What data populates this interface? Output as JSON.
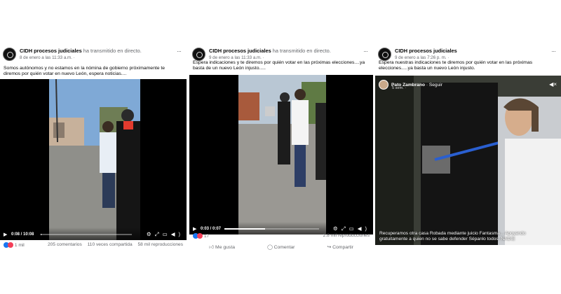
{
  "posts": [
    {
      "page_name": "CIDH procesos judiciales",
      "action": "ha transmitido en directo.",
      "date": "8 de enero a las 11:33 a.m. ·",
      "more": "···",
      "caption": "Somos autónomos y no estamos en la nómina de gobierno próximamente te diremos por quién votar en nuevo León, espera noticias....",
      "time": "0:08 / 10:08",
      "progress": 0.01,
      "reactions_count": "1 mil",
      "stats": [
        "205 comentarios",
        "110 veces compartida",
        "58 mil reproducciones"
      ],
      "icons": [
        "play-icon",
        "settings-icon",
        "fullscreen-icon",
        "pip-icon",
        "volume-icon"
      ]
    },
    {
      "page_name": "CIDH procesos judiciales",
      "action": "ha transmitido en directo.",
      "date": "9 de enero a las 11:33 a.m. ·",
      "more": "···",
      "caption": "Espera indicaciones y te diremos por quién votar en las próximas elecciones....ya basta de un nuevo León injusto.....",
      "time": "0:03 / 0:07",
      "progress": 0.43,
      "reactions_count": "17",
      "stats": [
        "2.8 mil reproducciones"
      ],
      "actions": [
        "Me gusta",
        "Comentar",
        "Compartir"
      ]
    },
    {
      "page_name": "CIDH procesos judiciales",
      "action": "",
      "date": "9 de enero a las 7:26 p. m. ·",
      "more": "···",
      "caption": "Espera nuestras indicaciones te diremos por quién votar en  las próximas elecciones.....ya basta un nuevo León injusto.",
      "overlay_user": "Pato Zambrano",
      "overlay_follow": "· Seguir",
      "overlay_time": "5 sem. ·",
      "overlay_caption": "Recuperamos otra casa Robada mediante juicio Fantasma... Apoyando gratuitamente a quien no se sabe defender Sépanlo todos: NADIE"
    }
  ],
  "colors": {
    "facebook_blue": "#1877f2",
    "love_red": "#f33e58",
    "secondary_text": "#65676b"
  }
}
